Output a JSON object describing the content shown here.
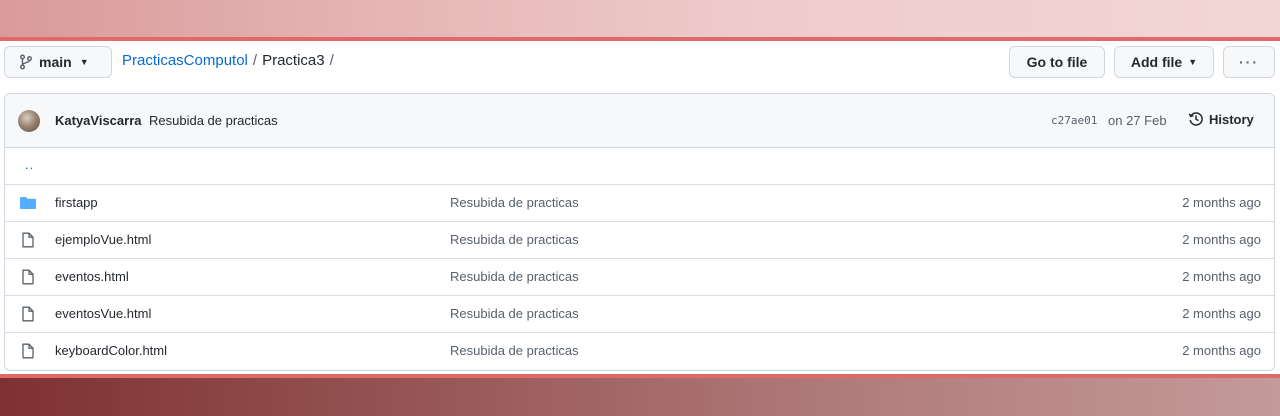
{
  "toolbar": {
    "branch": "main",
    "breadcrumb": {
      "repo": "PracticasComputol",
      "separator": "/",
      "folder": "Practica3",
      "trailing": "/"
    },
    "goto_file": "Go to file",
    "add_file": "Add file",
    "more": "···"
  },
  "commit": {
    "author": "KatyaViscarra",
    "message": "Resubida de practicas",
    "sha": "c27ae01",
    "date": "on 27 Feb",
    "history_label": "History"
  },
  "parent_link": "..",
  "files": [
    {
      "type": "folder",
      "name": "firstapp",
      "message": "Resubida de practicas",
      "age": "2 months ago"
    },
    {
      "type": "file",
      "name": "ejemploVue.html",
      "message": "Resubida de practicas",
      "age": "2 months ago"
    },
    {
      "type": "file",
      "name": "eventos.html",
      "message": "Resubida de practicas",
      "age": "2 months ago"
    },
    {
      "type": "file",
      "name": "eventosVue.html",
      "message": "Resubida de practicas",
      "age": "2 months ago"
    },
    {
      "type": "file",
      "name": "keyboardColor.html",
      "message": "Resubida de practicas",
      "age": "2 months ago"
    }
  ],
  "icons": {
    "branch": "git-branch-icon",
    "folder": "folder-icon",
    "file": "file-icon",
    "history": "clock-history-icon"
  },
  "colors": {
    "link": "#0969da",
    "folder": "#54aeff",
    "border": "#d0d7de",
    "header_bg": "#f6f8fa"
  }
}
